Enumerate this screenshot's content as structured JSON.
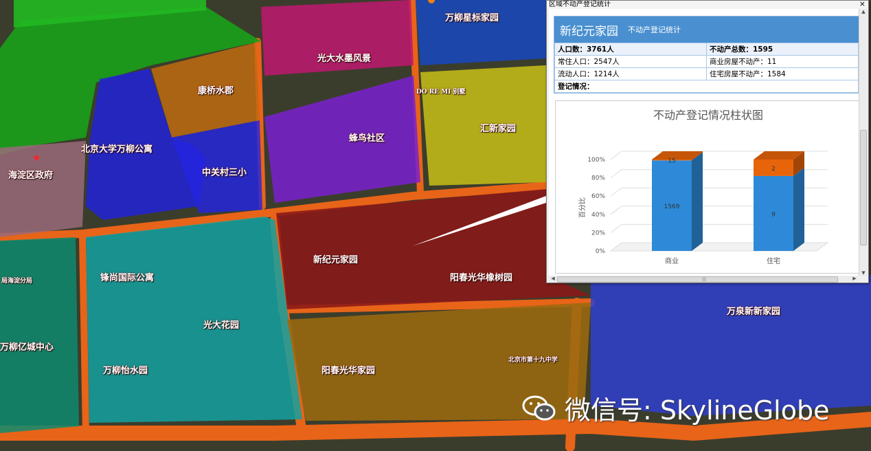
{
  "map": {
    "regions": [
      {
        "name": "万柳星标家园"
      },
      {
        "name": "光大水墨风景"
      },
      {
        "name": "康桥水郡"
      },
      {
        "name": "DO RE MI 别墅"
      },
      {
        "name": "北京大学万柳公寓"
      },
      {
        "name": "蜂鸟社区"
      },
      {
        "name": "汇新家园"
      },
      {
        "name": "海淀区政府"
      },
      {
        "name": "中关村三小"
      },
      {
        "name": "新纪元家园"
      },
      {
        "name": "阳春光华橡树园"
      },
      {
        "name": "锋尚国际公寓"
      },
      {
        "name": "局海淀分局"
      },
      {
        "name": "光大花园"
      },
      {
        "name": "万柳亿城中心"
      },
      {
        "name": "万柳怡水园"
      },
      {
        "name": "阳春光华家园"
      },
      {
        "name": "北京市第十九中学"
      },
      {
        "name": "万泉新新家园"
      }
    ]
  },
  "popup": {
    "window_title": "区域不动产登记统计",
    "close_glyph": "×",
    "header_title": "新纪元家园",
    "header_subtitle": "不动产登记统计",
    "rows": [
      [
        "人口数：3761人",
        "不动产总数：1595"
      ],
      [
        "常住人口：2547人",
        "商业房屋不动产：11"
      ],
      [
        "流动人口：1214人",
        "住宅房屋不动产：1584"
      ],
      [
        "登记情况：",
        ""
      ]
    ]
  },
  "chart_data": {
    "type": "bar",
    "title": "不动产登记情况柱状图",
    "ylabel": "百分比",
    "xlabel": "",
    "categories": [
      "商业",
      "住宅"
    ],
    "yticks": [
      "0%",
      "20%",
      "40%",
      "60%",
      "80%",
      "100%"
    ],
    "ylim": [
      0,
      100
    ],
    "stacked": true,
    "series": [
      {
        "color": "#2e8ad8",
        "labels": [
          "1569",
          "9"
        ],
        "percent": [
          99,
          82
        ]
      },
      {
        "color": "#e8640a",
        "labels": [
          "15",
          "2"
        ],
        "percent": [
          1,
          18
        ]
      }
    ]
  },
  "watermark": {
    "text": "微信号: SkylineGlobe"
  },
  "colors": {
    "road": "#e86418",
    "highlight_popup_header": "#4a90d0"
  }
}
